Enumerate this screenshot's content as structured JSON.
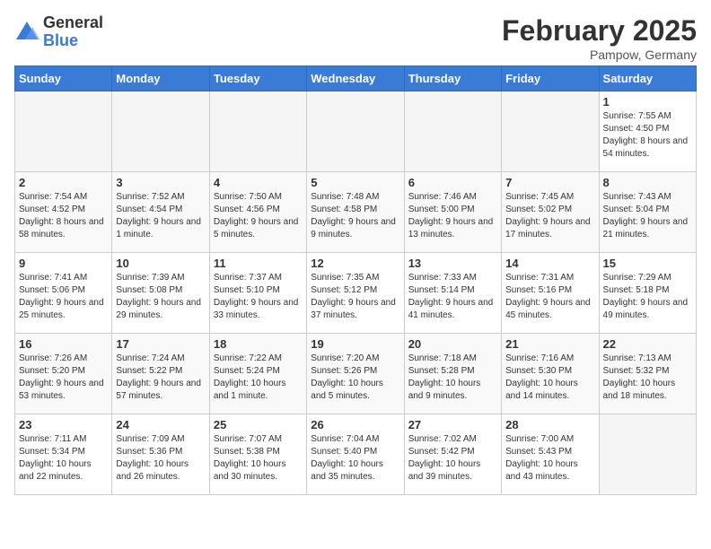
{
  "logo": {
    "general": "General",
    "blue": "Blue"
  },
  "title": "February 2025",
  "subtitle": "Pampow, Germany",
  "days_of_week": [
    "Sunday",
    "Monday",
    "Tuesday",
    "Wednesday",
    "Thursday",
    "Friday",
    "Saturday"
  ],
  "weeks": [
    [
      {
        "day": "",
        "info": ""
      },
      {
        "day": "",
        "info": ""
      },
      {
        "day": "",
        "info": ""
      },
      {
        "day": "",
        "info": ""
      },
      {
        "day": "",
        "info": ""
      },
      {
        "day": "",
        "info": ""
      },
      {
        "day": "1",
        "info": "Sunrise: 7:55 AM\nSunset: 4:50 PM\nDaylight: 8 hours and 54 minutes."
      }
    ],
    [
      {
        "day": "2",
        "info": "Sunrise: 7:54 AM\nSunset: 4:52 PM\nDaylight: 8 hours and 58 minutes."
      },
      {
        "day": "3",
        "info": "Sunrise: 7:52 AM\nSunset: 4:54 PM\nDaylight: 9 hours and 1 minute."
      },
      {
        "day": "4",
        "info": "Sunrise: 7:50 AM\nSunset: 4:56 PM\nDaylight: 9 hours and 5 minutes."
      },
      {
        "day": "5",
        "info": "Sunrise: 7:48 AM\nSunset: 4:58 PM\nDaylight: 9 hours and 9 minutes."
      },
      {
        "day": "6",
        "info": "Sunrise: 7:46 AM\nSunset: 5:00 PM\nDaylight: 9 hours and 13 minutes."
      },
      {
        "day": "7",
        "info": "Sunrise: 7:45 AM\nSunset: 5:02 PM\nDaylight: 9 hours and 17 minutes."
      },
      {
        "day": "8",
        "info": "Sunrise: 7:43 AM\nSunset: 5:04 PM\nDaylight: 9 hours and 21 minutes."
      }
    ],
    [
      {
        "day": "9",
        "info": "Sunrise: 7:41 AM\nSunset: 5:06 PM\nDaylight: 9 hours and 25 minutes."
      },
      {
        "day": "10",
        "info": "Sunrise: 7:39 AM\nSunset: 5:08 PM\nDaylight: 9 hours and 29 minutes."
      },
      {
        "day": "11",
        "info": "Sunrise: 7:37 AM\nSunset: 5:10 PM\nDaylight: 9 hours and 33 minutes."
      },
      {
        "day": "12",
        "info": "Sunrise: 7:35 AM\nSunset: 5:12 PM\nDaylight: 9 hours and 37 minutes."
      },
      {
        "day": "13",
        "info": "Sunrise: 7:33 AM\nSunset: 5:14 PM\nDaylight: 9 hours and 41 minutes."
      },
      {
        "day": "14",
        "info": "Sunrise: 7:31 AM\nSunset: 5:16 PM\nDaylight: 9 hours and 45 minutes."
      },
      {
        "day": "15",
        "info": "Sunrise: 7:29 AM\nSunset: 5:18 PM\nDaylight: 9 hours and 49 minutes."
      }
    ],
    [
      {
        "day": "16",
        "info": "Sunrise: 7:26 AM\nSunset: 5:20 PM\nDaylight: 9 hours and 53 minutes."
      },
      {
        "day": "17",
        "info": "Sunrise: 7:24 AM\nSunset: 5:22 PM\nDaylight: 9 hours and 57 minutes."
      },
      {
        "day": "18",
        "info": "Sunrise: 7:22 AM\nSunset: 5:24 PM\nDaylight: 10 hours and 1 minute."
      },
      {
        "day": "19",
        "info": "Sunrise: 7:20 AM\nSunset: 5:26 PM\nDaylight: 10 hours and 5 minutes."
      },
      {
        "day": "20",
        "info": "Sunrise: 7:18 AM\nSunset: 5:28 PM\nDaylight: 10 hours and 9 minutes."
      },
      {
        "day": "21",
        "info": "Sunrise: 7:16 AM\nSunset: 5:30 PM\nDaylight: 10 hours and 14 minutes."
      },
      {
        "day": "22",
        "info": "Sunrise: 7:13 AM\nSunset: 5:32 PM\nDaylight: 10 hours and 18 minutes."
      }
    ],
    [
      {
        "day": "23",
        "info": "Sunrise: 7:11 AM\nSunset: 5:34 PM\nDaylight: 10 hours and 22 minutes."
      },
      {
        "day": "24",
        "info": "Sunrise: 7:09 AM\nSunset: 5:36 PM\nDaylight: 10 hours and 26 minutes."
      },
      {
        "day": "25",
        "info": "Sunrise: 7:07 AM\nSunset: 5:38 PM\nDaylight: 10 hours and 30 minutes."
      },
      {
        "day": "26",
        "info": "Sunrise: 7:04 AM\nSunset: 5:40 PM\nDaylight: 10 hours and 35 minutes."
      },
      {
        "day": "27",
        "info": "Sunrise: 7:02 AM\nSunset: 5:42 PM\nDaylight: 10 hours and 39 minutes."
      },
      {
        "day": "28",
        "info": "Sunrise: 7:00 AM\nSunset: 5:43 PM\nDaylight: 10 hours and 43 minutes."
      },
      {
        "day": "",
        "info": ""
      }
    ]
  ]
}
